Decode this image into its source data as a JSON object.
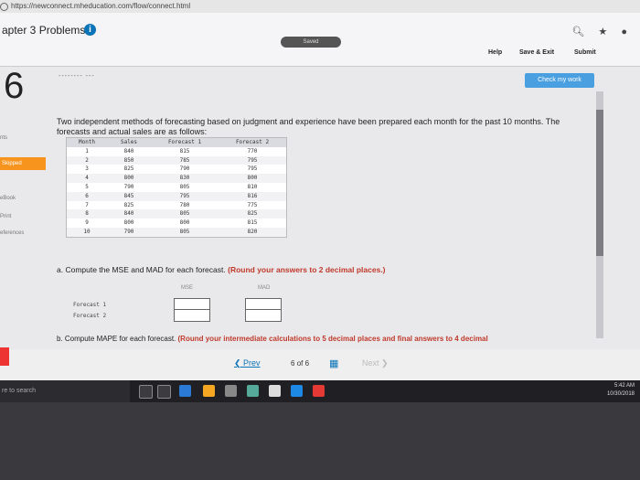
{
  "browser": {
    "url": "https://newconnect.mheducation.com/flow/connect.html",
    "icons": [
      "search-icon",
      "star-icon",
      "user-icon"
    ]
  },
  "header": {
    "chapter_title": "apter 3 Problems",
    "info_icon": "i",
    "saved_label": "Saved",
    "help_label": "Help",
    "save_exit_label": "Save & Exit",
    "submit_label": "Submit",
    "check_work_label": "Check my work"
  },
  "question": {
    "number": "6",
    "dashes": "-------- ---",
    "text": "Two independent methods of forecasting based on judgment and experience have been prepared each month for the past 10 months. The forecasts and actual sales are as follows:"
  },
  "sidebar": {
    "items": [
      {
        "label": "nts"
      },
      {
        "label": "Skipped"
      },
      {
        "label": "eBook"
      },
      {
        "label": "Print"
      },
      {
        "label": "eferences"
      }
    ]
  },
  "table": {
    "headers": [
      "Month",
      "Sales",
      "Forecast 1",
      "Forecast 2"
    ],
    "rows": [
      [
        "1",
        "840",
        "815",
        "770"
      ],
      [
        "2",
        "850",
        "785",
        "795"
      ],
      [
        "3",
        "825",
        "790",
        "795"
      ],
      [
        "4",
        "800",
        "830",
        "800"
      ],
      [
        "5",
        "790",
        "805",
        "810"
      ],
      [
        "6",
        "845",
        "795",
        "816"
      ],
      [
        "7",
        "825",
        "780",
        "775"
      ],
      [
        "8",
        "840",
        "805",
        "825"
      ],
      [
        "9",
        "800",
        "800",
        "815"
      ],
      [
        "10",
        "790",
        "805",
        "820"
      ]
    ]
  },
  "part_a": {
    "text": "a. Compute the MSE and MAD for each forecast.",
    "round_note": "(Round your answers to 2 decimal places.)",
    "mse_header": "MSE",
    "mad_header": "MAD",
    "forecast1_label": "Forecast 1",
    "forecast2_label": "Forecast 2",
    "forecast1_mse": "",
    "forecast1_mad": "",
    "forecast2_mse": "",
    "forecast2_mad": ""
  },
  "part_b": {
    "text": "b. Compute MAPE for each forecast.",
    "round_note": "(Round your intermediate calculations to 5 decimal places and final answers to 4 decimal"
  },
  "nav": {
    "prev_label": "Prev",
    "page_current": "6",
    "page_of": "of",
    "page_total": "6",
    "next_label": "Next"
  },
  "taskbar": {
    "search_text": "re to search",
    "time": "5:42 AM",
    "date": "10/30/2018"
  }
}
